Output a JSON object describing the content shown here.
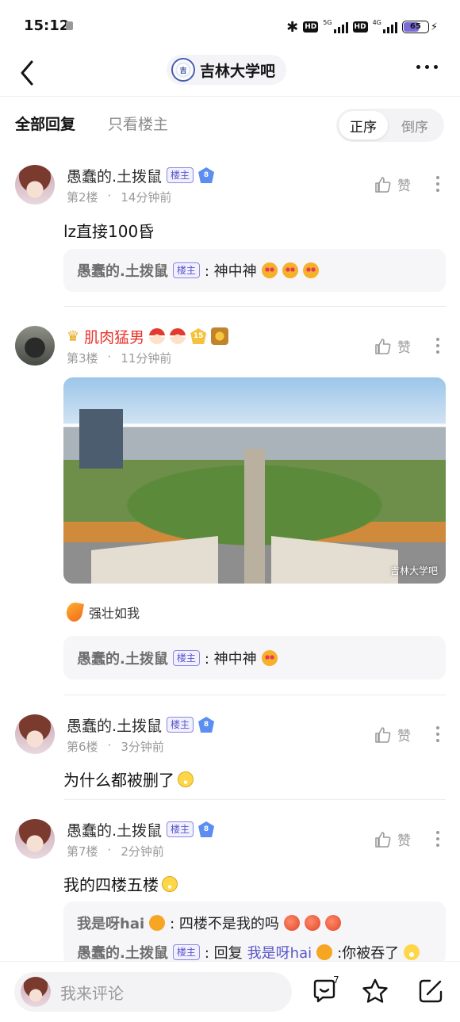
{
  "status_bar": {
    "time": "15:12",
    "network_5g": "5G",
    "network_4g": "4G",
    "hd": "HD",
    "battery": "65"
  },
  "nav": {
    "forum_name": "吉林大学吧"
  },
  "filter": {
    "all_replies": "全部回复",
    "host_only": "只看楼主",
    "order_asc": "正序",
    "order_desc": "倒序"
  },
  "colors": {
    "accent_purple": "#5a55c8",
    "vip_red": "#e8332c"
  },
  "posts": [
    {
      "user": "愚蠢的.土拨鼠",
      "host_tag": "楼主",
      "level": "8",
      "floor": "第2楼",
      "time": "14分钟前",
      "like": "赞",
      "content": "lz直接100昏",
      "replies": [
        {
          "user": "愚蠢的.土拨鼠",
          "tag": "楼主",
          "text": ": 神中神"
        }
      ]
    },
    {
      "user": "肌肉猛男",
      "level": "15",
      "floor": "第3楼",
      "time": "11分钟前",
      "like": "赞",
      "image_watermark": "吉林大学吧",
      "signature": "强壮如我",
      "replies": [
        {
          "user": "愚蠢的.土拨鼠",
          "tag": "楼主",
          "text": ": 神中神"
        }
      ]
    },
    {
      "user": "愚蠢的.土拨鼠",
      "host_tag": "楼主",
      "level": "8",
      "floor": "第6楼",
      "time": "3分钟前",
      "like": "赞",
      "content": "为什么都被删了"
    },
    {
      "user": "愚蠢的.土拨鼠",
      "host_tag": "楼主",
      "level": "8",
      "floor": "第7楼",
      "time": "2分钟前",
      "like": "赞",
      "content": "我的四楼五楼",
      "replies": [
        {
          "user": "我是呀hai",
          "text": ": 四楼不是我的吗"
        },
        {
          "user": "愚蠢的.土拨鼠",
          "tag": "楼主",
          "prefix": ": 回复",
          "reply_to": "我是呀hai",
          "text": ":你被吞了"
        }
      ]
    }
  ],
  "bottom_bar": {
    "placeholder": "我来评论",
    "comment_count": "7"
  }
}
